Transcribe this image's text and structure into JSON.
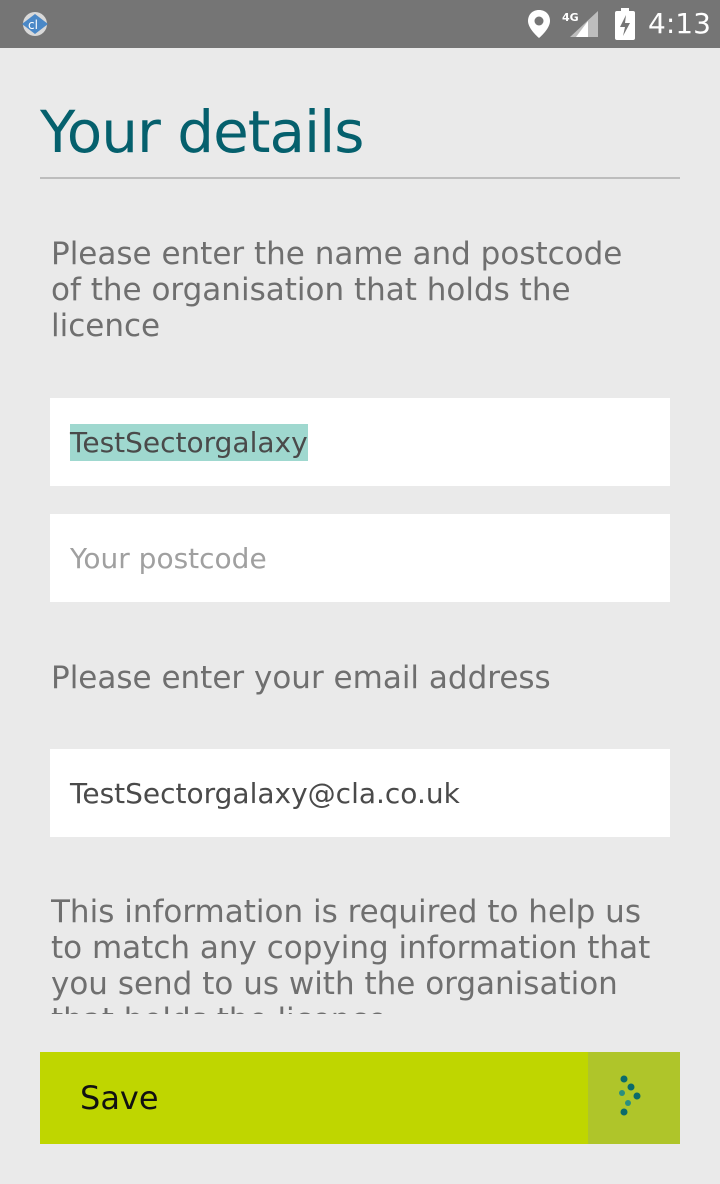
{
  "status_bar": {
    "time": "4:13",
    "network": "4G",
    "icons": [
      "app-notification-icon",
      "location-icon",
      "signal-icon",
      "battery-charging-icon"
    ]
  },
  "page": {
    "title": "Your details",
    "org_instructions": "Please enter the name and postcode of the organisation that holds the licence",
    "email_instructions": "Please enter your email address",
    "info_text": "This information is required to help us to match any copying information that you send to us with the organisation that holds the licence"
  },
  "fields": {
    "organisation_name": {
      "value": "TestSectorgalaxy",
      "placeholder": ""
    },
    "postcode": {
      "value": "",
      "placeholder": "Your postcode"
    },
    "email": {
      "value": "TestSectorgalaxy@cla.co.uk",
      "placeholder": ""
    }
  },
  "footer": {
    "save_label": "Save",
    "save_icon": "dotted-arrow-icon",
    "colors": {
      "save_bg": "#bfd600",
      "icon_bg": "#afc52a",
      "title": "#05606d"
    }
  }
}
